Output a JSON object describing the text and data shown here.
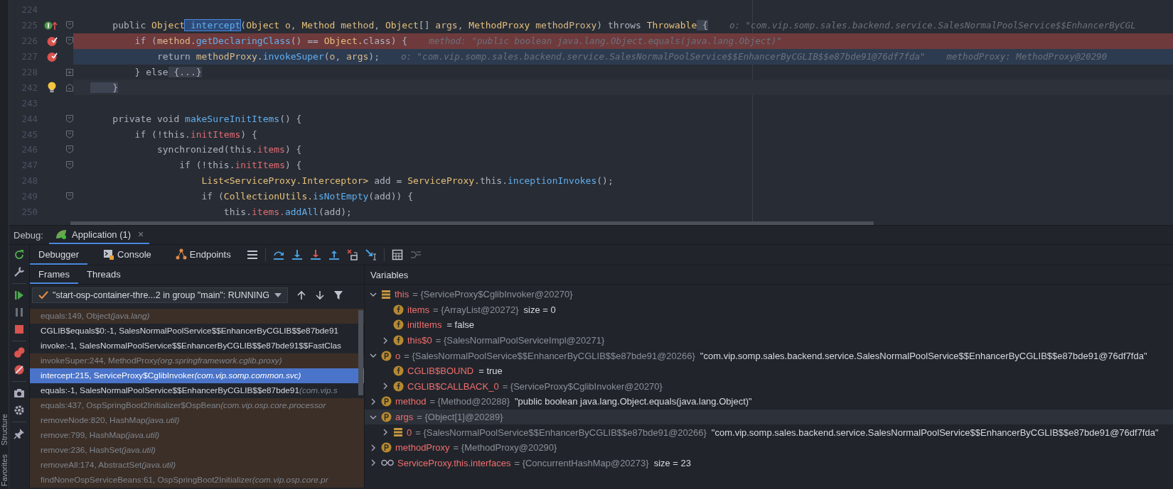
{
  "side_tabs": [
    "Structure",
    "Favorites"
  ],
  "editor": {
    "lines": [
      {
        "number": "224",
        "kind": "plain",
        "breakpoint": false,
        "execution_point": false,
        "caret_line": false,
        "fold_start": false,
        "fold_end": false,
        "folded": false
      },
      {
        "number": "225",
        "kind": "method",
        "breakpoint": false,
        "execution_point": false,
        "caret_line": false,
        "fold_start": true,
        "fold_end": false,
        "folded": false,
        "code": [
          {
            "text": "    public",
            "kind": "keyword"
          },
          {
            "text": " Object",
            "kind": "type"
          },
          {
            "text": " intercept",
            "kind": "match"
          },
          {
            "text": "(",
            "kind": "plain"
          },
          {
            "text": "Object",
            "kind": "type"
          },
          {
            "text": " o",
            "kind": "param"
          },
          {
            "text": ",",
            "kind": "plain"
          },
          {
            "text": " Method",
            "kind": "type"
          },
          {
            "text": " method",
            "kind": "param"
          },
          {
            "text": ",",
            "kind": "plain"
          },
          {
            "text": " Object",
            "kind": "type"
          },
          {
            "text": "[]",
            "kind": "plain"
          },
          {
            "text": " args",
            "kind": "param"
          },
          {
            "text": ",",
            "kind": "plain"
          },
          {
            "text": " MethodProxy",
            "kind": "type"
          },
          {
            "text": " methodProxy",
            "kind": "param"
          },
          {
            "text": ")",
            "kind": "plain"
          },
          {
            "text": " throws",
            "kind": "keyword"
          },
          {
            "text": " Throwable",
            "kind": "type"
          },
          {
            "text": " {",
            "kind": "brace"
          }
        ],
        "hints": [
          "o: \"com.vip.somp.sales.backend.service.SalesNormalPoolService$$EnhancerByCGL"
        ]
      },
      {
        "number": "226",
        "kind": "plain",
        "breakpoint": true,
        "execution_point": false,
        "caret_line": false,
        "fold_start": true,
        "fold_end": false,
        "folded": false,
        "code": [
          {
            "text": "        if",
            "kind": "keyword"
          },
          {
            "text": " (",
            "kind": "plain"
          },
          {
            "text": "method.",
            "kind": "param"
          },
          {
            "text": "getDeclaringClass",
            "kind": "call"
          },
          {
            "text": "() ==",
            "kind": "plain"
          },
          {
            "text": " Object.",
            "kind": "type"
          },
          {
            "text": "class",
            "kind": "keyword"
          },
          {
            "text": ") {",
            "kind": "plain"
          }
        ],
        "hints": [
          "method: \"public boolean java.lang.Object.equals(java.lang.Object)\""
        ]
      },
      {
        "number": "227",
        "kind": "plain",
        "breakpoint": true,
        "execution_point": true,
        "caret_line": false,
        "fold_start": false,
        "fold_end": false,
        "folded": false,
        "code": [
          {
            "text": "            return",
            "kind": "keyword"
          },
          {
            "text": " methodProxy.",
            "kind": "param"
          },
          {
            "text": "invokeSuper",
            "kind": "call"
          },
          {
            "text": "(",
            "kind": "plain"
          },
          {
            "text": "o",
            "kind": "param"
          },
          {
            "text": ",",
            "kind": "plain"
          },
          {
            "text": " args",
            "kind": "param"
          },
          {
            "text": ");",
            "kind": "plain"
          }
        ],
        "hints": [
          "o: \"com.vip.somp.sales.backend.service.SalesNormalPoolService$$EnhancerByCGLIB$$e87bde91@76df7fda\"",
          "methodProxy: MethodProxy@20290"
        ]
      },
      {
        "number": "228",
        "kind": "plain",
        "breakpoint": false,
        "execution_point": false,
        "caret_line": false,
        "fold_start": false,
        "fold_end": false,
        "folded": true,
        "code": [
          {
            "text": "        }",
            "kind": "plain"
          },
          {
            "text": " else",
            "kind": "keyword"
          },
          {
            "text": " {...}",
            "kind": "folded"
          }
        ]
      },
      {
        "number": "242",
        "kind": "hint",
        "breakpoint": false,
        "execution_point": false,
        "caret_line": true,
        "fold_start": false,
        "fold_end": true,
        "folded": false,
        "code": [
          {
            "text": "    }",
            "kind": "brace"
          }
        ]
      },
      {
        "number": "243",
        "kind": "plain",
        "breakpoint": false,
        "execution_point": false,
        "caret_line": false,
        "fold_start": false,
        "fold_end": false,
        "folded": false
      },
      {
        "number": "244",
        "kind": "plain",
        "breakpoint": false,
        "execution_point": false,
        "caret_line": false,
        "fold_start": true,
        "fold_end": false,
        "folded": false,
        "code": [
          {
            "text": "    private",
            "kind": "keyword"
          },
          {
            "text": " void",
            "kind": "keyword"
          },
          {
            "text": " makeSureInitItems",
            "kind": "call"
          },
          {
            "text": "() {",
            "kind": "plain"
          }
        ]
      },
      {
        "number": "245",
        "kind": "plain",
        "breakpoint": false,
        "execution_point": false,
        "caret_line": false,
        "fold_start": true,
        "fold_end": false,
        "folded": false,
        "code": [
          {
            "text": "        if",
            "kind": "keyword"
          },
          {
            "text": " (!",
            "kind": "plain"
          },
          {
            "text": "this.",
            "kind": "keyword"
          },
          {
            "text": "initItems",
            "kind": "field"
          },
          {
            "text": ") {",
            "kind": "plain"
          }
        ]
      },
      {
        "number": "246",
        "kind": "plain",
        "breakpoint": false,
        "execution_point": false,
        "caret_line": false,
        "fold_start": true,
        "fold_end": false,
        "folded": false,
        "code": [
          {
            "text": "            synchronized",
            "kind": "keyword"
          },
          {
            "text": "(",
            "kind": "plain"
          },
          {
            "text": "this.",
            "kind": "keyword"
          },
          {
            "text": "items",
            "kind": "field"
          },
          {
            "text": ") {",
            "kind": "plain"
          }
        ]
      },
      {
        "number": "247",
        "kind": "plain",
        "breakpoint": false,
        "execution_point": false,
        "caret_line": false,
        "fold_start": true,
        "fold_end": false,
        "folded": false,
        "code": [
          {
            "text": "                if",
            "kind": "keyword"
          },
          {
            "text": " (!",
            "kind": "plain"
          },
          {
            "text": "this.",
            "kind": "keyword"
          },
          {
            "text": "initItems",
            "kind": "field"
          },
          {
            "text": ") {",
            "kind": "plain"
          }
        ]
      },
      {
        "number": "248",
        "kind": "plain",
        "breakpoint": false,
        "execution_point": false,
        "caret_line": false,
        "fold_start": false,
        "fold_end": false,
        "folded": false,
        "code": [
          {
            "text": "                    List<ServiceProxy.Interceptor>",
            "kind": "type"
          },
          {
            "text": " add =",
            "kind": "plain"
          },
          {
            "text": " ServiceProxy.",
            "kind": "type"
          },
          {
            "text": "this.",
            "kind": "keyword"
          },
          {
            "text": "inceptionInvokes",
            "kind": "call"
          },
          {
            "text": "();",
            "kind": "plain"
          }
        ]
      },
      {
        "number": "249",
        "kind": "plain",
        "breakpoint": false,
        "execution_point": false,
        "caret_line": false,
        "fold_start": true,
        "fold_end": false,
        "folded": false,
        "code": [
          {
            "text": "                    if",
            "kind": "keyword"
          },
          {
            "text": " (",
            "kind": "plain"
          },
          {
            "text": "CollectionUtils.",
            "kind": "type"
          },
          {
            "text": "isNotEmpty",
            "kind": "call"
          },
          {
            "text": "(add)) {",
            "kind": "plain"
          }
        ]
      },
      {
        "number": "250",
        "kind": "plain",
        "breakpoint": false,
        "execution_point": false,
        "caret_line": false,
        "fold_start": false,
        "fold_end": false,
        "folded": false,
        "code": [
          {
            "text": "                        this.",
            "kind": "keyword"
          },
          {
            "text": "items.",
            "kind": "field"
          },
          {
            "text": "addAll",
            "kind": "call"
          },
          {
            "text": "(add);",
            "kind": "plain"
          }
        ]
      }
    ]
  },
  "debug": {
    "label": "Debug:",
    "session": {
      "label": "Application (1)",
      "close": "×"
    }
  },
  "tabs": [
    {
      "label": "Debugger",
      "selected": true
    },
    {
      "label": "Console",
      "selected": false
    },
    {
      "label": "Endpoints",
      "selected": false
    }
  ],
  "frame_tabs": [
    {
      "label": "Frames",
      "selected": true
    },
    {
      "label": "Threads",
      "selected": false
    }
  ],
  "thread": {
    "value": "\"start-osp-container-thre...2 in group \"main\": RUNNING"
  },
  "frames": [
    {
      "method": "equals:149, Object",
      "package": "(java.lang)",
      "kind": "library",
      "selected": false
    },
    {
      "method": "CGLIB$equals$0:-1, SalesNormalPoolService$$EnhancerByCGLIB$$e87bde91",
      "kind": "project",
      "selected": false
    },
    {
      "method": "invoke:-1, SalesNormalPoolService$$EnhancerByCGLIB$$e87bde91$$FastClas",
      "kind": "project",
      "selected": false
    },
    {
      "method": "invokeSuper:244, MethodProxy",
      "package": "(org.springframework.cglib.proxy)",
      "kind": "library",
      "selected": false
    },
    {
      "method": "intercept:215, ServiceProxy$CglibInvoker",
      "package": "(com.vip.somp.common.svc)",
      "kind": "project",
      "selected": true
    },
    {
      "method": "equals:-1, SalesNormalPoolService$$EnhancerByCGLIB$$e87bde91",
      "package": "(com.vip.s",
      "kind": "project",
      "selected": false
    },
    {
      "method": "equals:437, OspSpringBoot2Initializer$OspBean",
      "package": "(com.vip.osp.core.processor",
      "kind": "library",
      "selected": false
    },
    {
      "method": "removeNode:820, HashMap",
      "package": "(java.util)",
      "kind": "library",
      "selected": false
    },
    {
      "method": "remove:799, HashMap",
      "package": "(java.util)",
      "kind": "library",
      "selected": false
    },
    {
      "method": "remove:236, HashSet",
      "package": "(java.util)",
      "kind": "library",
      "selected": false
    },
    {
      "method": "removeAll:174, AbstractSet",
      "package": "(java.util)",
      "kind": "library",
      "selected": false
    },
    {
      "method": "findNoneOspServiceBeans:61, OspSpringBoot2Initializer",
      "package": "(com.vip.osp.core.pr",
      "kind": "library",
      "selected": false
    }
  ],
  "variables": {
    "title": "Variables",
    "items": [
      {
        "name": "this",
        "kind": "object",
        "value": "= {ServiceProxy$CglibInvoker@20270}",
        "expanded": true,
        "selected": false,
        "children": [
          {
            "name": "items",
            "kind": "field",
            "value": "= {ArrayList@20272}",
            "text": "size = 0",
            "selected": false
          },
          {
            "name": "initItems",
            "kind": "field",
            "text": "= false",
            "selected": false
          },
          {
            "name": "this$0",
            "kind": "field",
            "value": "= {SalesNormalPoolServiceImpl@20271}",
            "expanded": false,
            "selected": false
          }
        ]
      },
      {
        "name": "o",
        "kind": "parameter",
        "value": "= {SalesNormalPoolService$$EnhancerByCGLIB$$e87bde91@20266}",
        "text": "\"com.vip.somp.sales.backend.service.SalesNormalPoolService$$EnhancerByCGLIB$$e87bde91@76df7fda\"",
        "expanded": true,
        "selected": false,
        "children": [
          {
            "name": "CGLIB$BOUND",
            "kind": "field",
            "text": "= true",
            "selected": false
          },
          {
            "name": "CGLIB$CALLBACK_0",
            "kind": "field",
            "value": "= {ServiceProxy$CglibInvoker@20270}",
            "expanded": false,
            "selected": false
          }
        ]
      },
      {
        "name": "method",
        "kind": "parameter",
        "value": "= {Method@20288}",
        "text": "\"public boolean java.lang.Object.equals(java.lang.Object)\"",
        "expanded": false,
        "selected": false
      },
      {
        "name": "args",
        "kind": "parameter",
        "value": "= {Object[1]@20289}",
        "expanded": true,
        "selected": true,
        "children": [
          {
            "name": "0",
            "kind": "object",
            "value": "= {SalesNormalPoolService$$EnhancerByCGLIB$$e87bde91@20266}",
            "text": "\"com.vip.somp.sales.backend.service.SalesNormalPoolService$$EnhancerByCGLIB$$e87bde91@76df7fda\"",
            "expanded": false,
            "selected": false
          }
        ]
      },
      {
        "name": "methodProxy",
        "kind": "parameter",
        "value": "= {MethodProxy@20290}",
        "expanded": false,
        "selected": false
      },
      {
        "name": "ServiceProxy.this.interfaces",
        "kind": "watch",
        "value": "= {ConcurrentHashMap@20273}",
        "text": "size = 23",
        "expanded": false,
        "selected": false
      }
    ]
  }
}
